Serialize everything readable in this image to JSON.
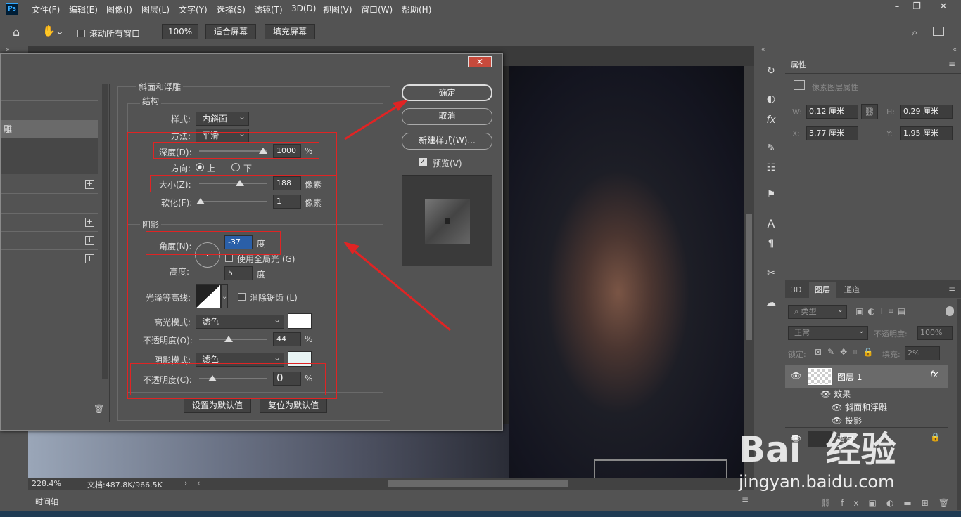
{
  "app": {
    "logo": "Ps"
  },
  "menu": [
    "文件(F)",
    "编辑(E)",
    "图像(I)",
    "图层(L)",
    "文字(Y)",
    "选择(S)",
    "滤镜(T)",
    "3D(D)",
    "视图(V)",
    "窗口(W)",
    "帮助(H)"
  ],
  "options": {
    "scroll_all": "滚动所有窗口",
    "zoom": "100%",
    "fit_screen": "适合屏幕",
    "fill_screen": "填充屏幕"
  },
  "status": {
    "zoom": "228.4%",
    "doc": "文档:487.8K/966.5K",
    "timeline": "时间轴"
  },
  "properties": {
    "tab": "属性",
    "type_label": "像素图层属性",
    "w_label": "W:",
    "w": "0.12 厘米",
    "h_label": "H:",
    "h": "0.29 厘米",
    "x_label": "X:",
    "x": "3.77 厘米",
    "y_label": "Y:",
    "y": "1.95 厘米"
  },
  "layers": {
    "tabs": [
      "3D",
      "图层",
      "通道"
    ],
    "kind": "类型",
    "blend": "正常",
    "opacity_label": "不透明度:",
    "opacity": "100%",
    "lock_label": "锁定:",
    "fill_label": "填充:",
    "fill": "2%",
    "items": [
      {
        "name": "图层 1",
        "fx": "fx"
      },
      {
        "name": "效果"
      },
      {
        "name": "斜面和浮雕"
      },
      {
        "name": "投影"
      },
      {
        "name": "背景"
      }
    ]
  },
  "dialog": {
    "left_styles": [
      "雕"
    ],
    "section_title": "斜面和浮雕",
    "structure": "结构",
    "style_label": "样式:",
    "style_value": "内斜面",
    "technique_label": "方法:",
    "technique_value": "平滑",
    "depth_label": "深度(D):",
    "depth_value": "1000",
    "depth_unit": "%",
    "direction_label": "方向:",
    "dir_up": "上",
    "dir_down": "下",
    "size_label": "大小(Z):",
    "size_value": "188",
    "size_unit": "像素",
    "soften_label": "软化(F):",
    "soften_value": "1",
    "soften_unit": "像素",
    "shading": "阴影",
    "angle_label": "角度(N):",
    "angle_value": "-37",
    "angle_unit": "度",
    "global_light": "使用全局光 (G)",
    "altitude_label": "高度:",
    "altitude_value": "5",
    "altitude_unit": "度",
    "gloss_label": "光泽等高线:",
    "antialias": "消除锯齿 (L)",
    "highlight_mode_label": "高光模式:",
    "highlight_mode": "滤色",
    "highlight_opacity_label": "不透明度(O):",
    "highlight_opacity": "44",
    "highlight_opacity_unit": "%",
    "shadow_mode_label": "阴影模式:",
    "shadow_mode": "滤色",
    "shadow_opacity_label": "不透明度(C):",
    "shadow_opacity": "0",
    "shadow_opacity_unit": "%",
    "set_default": "设置为默认值",
    "reset_default": "复位为默认值",
    "ok": "确定",
    "cancel": "取消",
    "new_style": "新建样式(W)...",
    "preview": "预览(V)",
    "depth_level": 0.95,
    "size_level": 0.6,
    "soften_level": 0.02,
    "highlight_level": 0.44,
    "shadow_level": 0.2
  },
  "watermark": {
    "brand": "Bai  经验",
    "url": "jingyan.baidu.com"
  },
  "colors": {
    "accent_red": "#e02424",
    "close_red": "#c74a3c",
    "highlight_swatch": "#ffffff",
    "shadow_swatch": "#e8f4f4"
  }
}
